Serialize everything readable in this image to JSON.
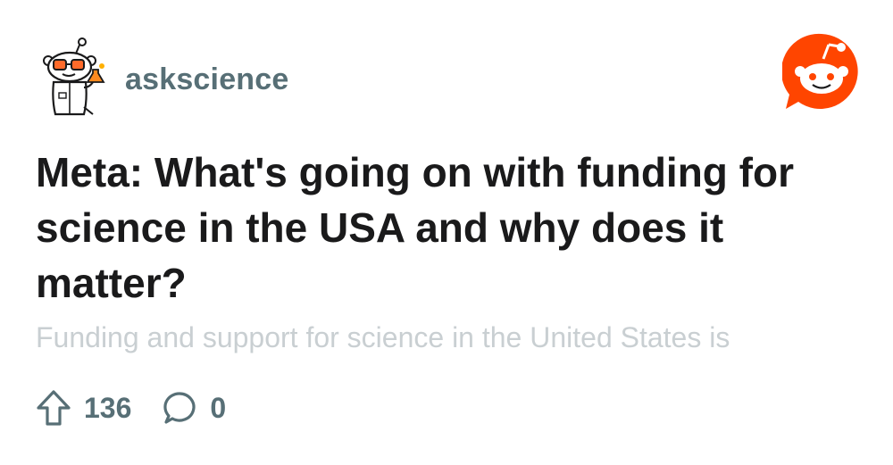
{
  "subreddit": {
    "name": "askscience",
    "avatar_icon": "scientist-snoo-icon"
  },
  "brand": {
    "logo_icon": "reddit-logo-icon",
    "color": "#ff4500"
  },
  "post": {
    "title": "Meta: What's going on with funding for science in the USA and why does it matter?",
    "preview": "Funding and support for science in the United States is"
  },
  "stats": {
    "upvotes": "136",
    "upvote_icon": "upvote-arrow-icon",
    "comments": "0",
    "comment_icon": "comment-bubble-icon"
  }
}
